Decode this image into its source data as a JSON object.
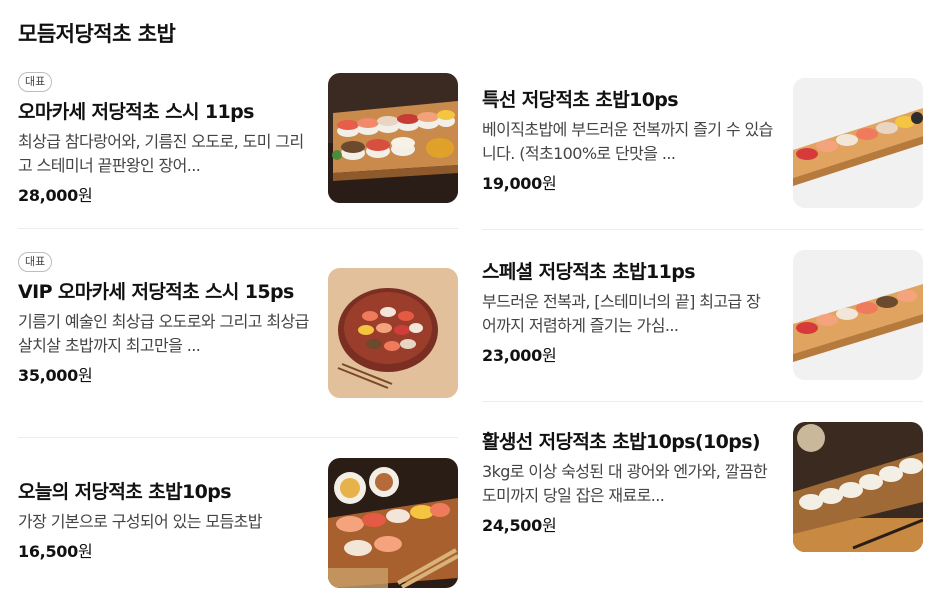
{
  "section": {
    "title": "모듬저당적초 초밥"
  },
  "left": [
    {
      "badge": "대표",
      "name": "오마카세 저당적초 스시 11ps",
      "desc": "최상급 참다랑어와, 기름진 오도로, 도미 그리고 스테미너 끝판왕인 장어...",
      "price": "28,000",
      "unit": "원",
      "image": "sushi-platter-wood-board"
    },
    {
      "badge": "대표",
      "name": "VIP 오마카세 저당적초 스시 15ps",
      "desc": "기름기 예술인 최상급 오도로와 그리고 최상급 살치살 초밥까지 최고만을 ...",
      "price": "35,000",
      "unit": "원",
      "image": "sushi-round-plate"
    },
    {
      "badge": "",
      "name": "오늘의 저당적초 초밥10ps",
      "desc": "가장 기본으로 구성되어 있는 모듬초밥",
      "price": "16,500",
      "unit": "원",
      "image": "sushi-spread-dark"
    }
  ],
  "right": [
    {
      "name": "특선 저당적초 초밥10ps",
      "desc": "베이직초밥에 부드러운 전복까지 즐기 수 있습니다. (적초100%로 단맛을 ...",
      "price": "19,000",
      "unit": "원",
      "image": "sushi-wood-tray-1"
    },
    {
      "name": "스페셜 저당적초 초밥11ps",
      "desc": "부드러운 전복과, [스테미너의 끝] 최고급 장어까지 저렴하게 즐기는 가심...",
      "price": "23,000",
      "unit": "원",
      "image": "sushi-wood-tray-2"
    },
    {
      "name": "활생선 저당적초 초밥10ps(10ps)",
      "desc": "3kg로 이상 숙성된 대 광어와 엔가와, 깔끔한 도미까지 당일 잡은 재료로...",
      "price": "24,500",
      "unit": "원",
      "image": "sushi-white-fish-board"
    }
  ]
}
